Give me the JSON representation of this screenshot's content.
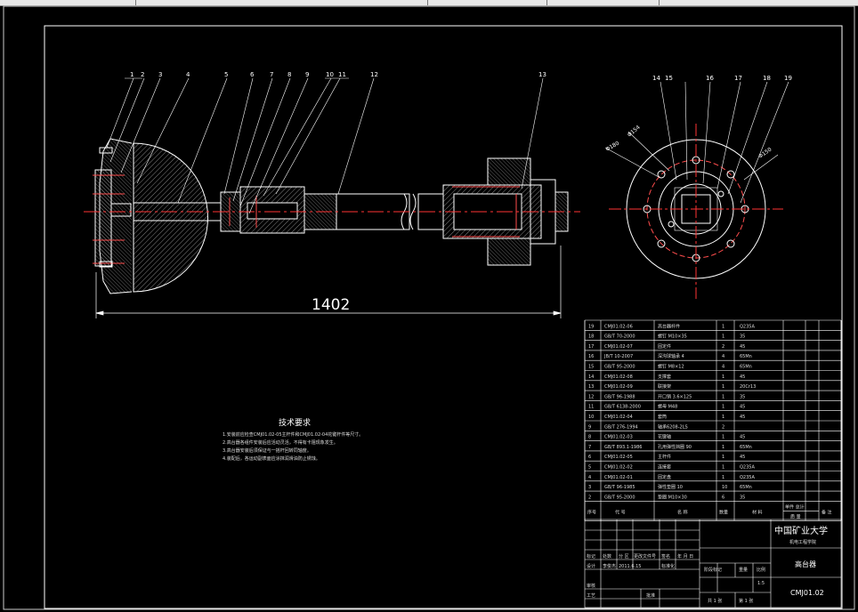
{
  "window": {
    "toolbar_segments": [
      "",
      "",
      "",
      "",
      ""
    ]
  },
  "dimension": {
    "overall_length": "1402"
  },
  "callouts": {
    "main": [
      "1",
      "2",
      "3",
      "4",
      "5",
      "6",
      "7",
      "8",
      "9",
      "10",
      "11",
      "12",
      "13"
    ],
    "side": [
      "14",
      "15",
      "16",
      "17",
      "18",
      "19"
    ]
  },
  "side_dims": {
    "d1": "Φ180",
    "d2": "Φ154",
    "d3": "Φ150"
  },
  "notes": {
    "title": "技术要求",
    "lines": [
      "1.安装前应检查CMJ01.02-05主杆件和CMJ01.02-04花键杆件等尺寸。",
      "2.高台器各组件安装后应活动灵活，不得有卡阻现象发生。",
      "3.高台器安装后须保证与一摇杆回转同轴度。",
      "4.装配后，各运动副表面应涂抹润滑油防止锈蚀。"
    ]
  },
  "bom": {
    "rows": [
      {
        "no": "19",
        "code": "CMJ01.02-06",
        "name": "高台器杆件",
        "qty": "1",
        "material": "Q235A",
        "mass": "",
        "note": ""
      },
      {
        "no": "18",
        "code": "GB/T 70-2000",
        "name": "螺钉 M10×35",
        "qty": "1",
        "material": "35",
        "mass": "",
        "note": ""
      },
      {
        "no": "17",
        "code": "CMJ01.02-07",
        "name": "固定件",
        "qty": "2",
        "material": "45",
        "mass": "",
        "note": ""
      },
      {
        "no": "16",
        "code": "JB/T 10-2007",
        "name": "深沟球轴承 4",
        "qty": "4",
        "material": "65Mn",
        "mass": "",
        "note": ""
      },
      {
        "no": "15",
        "code": "GB/T 95-2000",
        "name": "螺钉 M8×12",
        "qty": "4",
        "material": "65Mn",
        "mass": "",
        "note": ""
      },
      {
        "no": "14",
        "code": "CMJ01.02-08",
        "name": "支撑套",
        "qty": "1",
        "material": "45",
        "mass": "",
        "note": ""
      },
      {
        "no": "13",
        "code": "CMJ01.02-09",
        "name": "联接架",
        "qty": "1",
        "material": "20Cr13",
        "mass": "",
        "note": ""
      },
      {
        "no": "12",
        "code": "GB/T 96-1988",
        "name": "开口销 3.6×125",
        "qty": "1",
        "material": "35",
        "mass": "",
        "note": ""
      },
      {
        "no": "11",
        "code": "GB/T 6138-2000",
        "name": "螺母 M48",
        "qty": "1",
        "material": "45",
        "mass": "",
        "note": ""
      },
      {
        "no": "10",
        "code": "CMJ01.02-04",
        "name": "套筒",
        "qty": "1",
        "material": "45",
        "mass": "",
        "note": ""
      },
      {
        "no": "9",
        "code": "GB/T 276-1994",
        "name": "轴承6208-2LS",
        "qty": "2",
        "material": "",
        "mass": "",
        "note": ""
      },
      {
        "no": "8",
        "code": "CMJ01.02-03",
        "name": "花键轴",
        "qty": "1",
        "material": "45",
        "mass": "",
        "note": ""
      },
      {
        "no": "7",
        "code": "GB/T 893.1-1986",
        "name": "孔用弹性挡圈 90",
        "qty": "1",
        "material": "65Mn",
        "mass": "",
        "note": ""
      },
      {
        "no": "6",
        "code": "CMJ01.02-05",
        "name": "主杆件",
        "qty": "1",
        "material": "45",
        "mass": "",
        "note": ""
      },
      {
        "no": "5",
        "code": "CMJ01.02-02",
        "name": "连接套",
        "qty": "1",
        "material": "Q235A",
        "mass": "",
        "note": ""
      },
      {
        "no": "4",
        "code": "CMJ01.02-01",
        "name": "固定盘",
        "qty": "1",
        "material": "Q235A",
        "mass": "",
        "note": ""
      },
      {
        "no": "3",
        "code": "GB/T 96-1985",
        "name": "弹性垫圈 10",
        "qty": "10",
        "material": "65Mn",
        "mass": "",
        "note": ""
      },
      {
        "no": "2",
        "code": "GB/T 95-2000",
        "name": "垫圈 M10×30",
        "qty": "6",
        "material": "35",
        "mass": "",
        "note": ""
      }
    ],
    "header": {
      "no": "序号",
      "code": "代 号",
      "name": "名 称",
      "qty": "数量",
      "material": "材 料",
      "mass_top": "单件 总计",
      "mass_bottom": "质 量",
      "note": "备 注"
    }
  },
  "title_block": {
    "school": "中国矿业大学",
    "college": "机电工程学院",
    "drawing_name": "高台器",
    "drawing_no": "CMJ01.02",
    "scale": "1:5",
    "sheets": "共 1 张",
    "sheet": "第 1 张",
    "labels": {
      "mark": "标记",
      "count": "处数",
      "zone": "分 区",
      "change_doc": "更改文件号",
      "sign": "签名",
      "date": "年 月 日",
      "design": "设计",
      "design_name": "李俊杰",
      "design_date": "2011.6.15",
      "standardize": "标准化",
      "stage": "阶段标记",
      "weight": "重量",
      "scale_label": "比例",
      "review": "审核",
      "process": "工艺",
      "approve": "批准"
    }
  }
}
